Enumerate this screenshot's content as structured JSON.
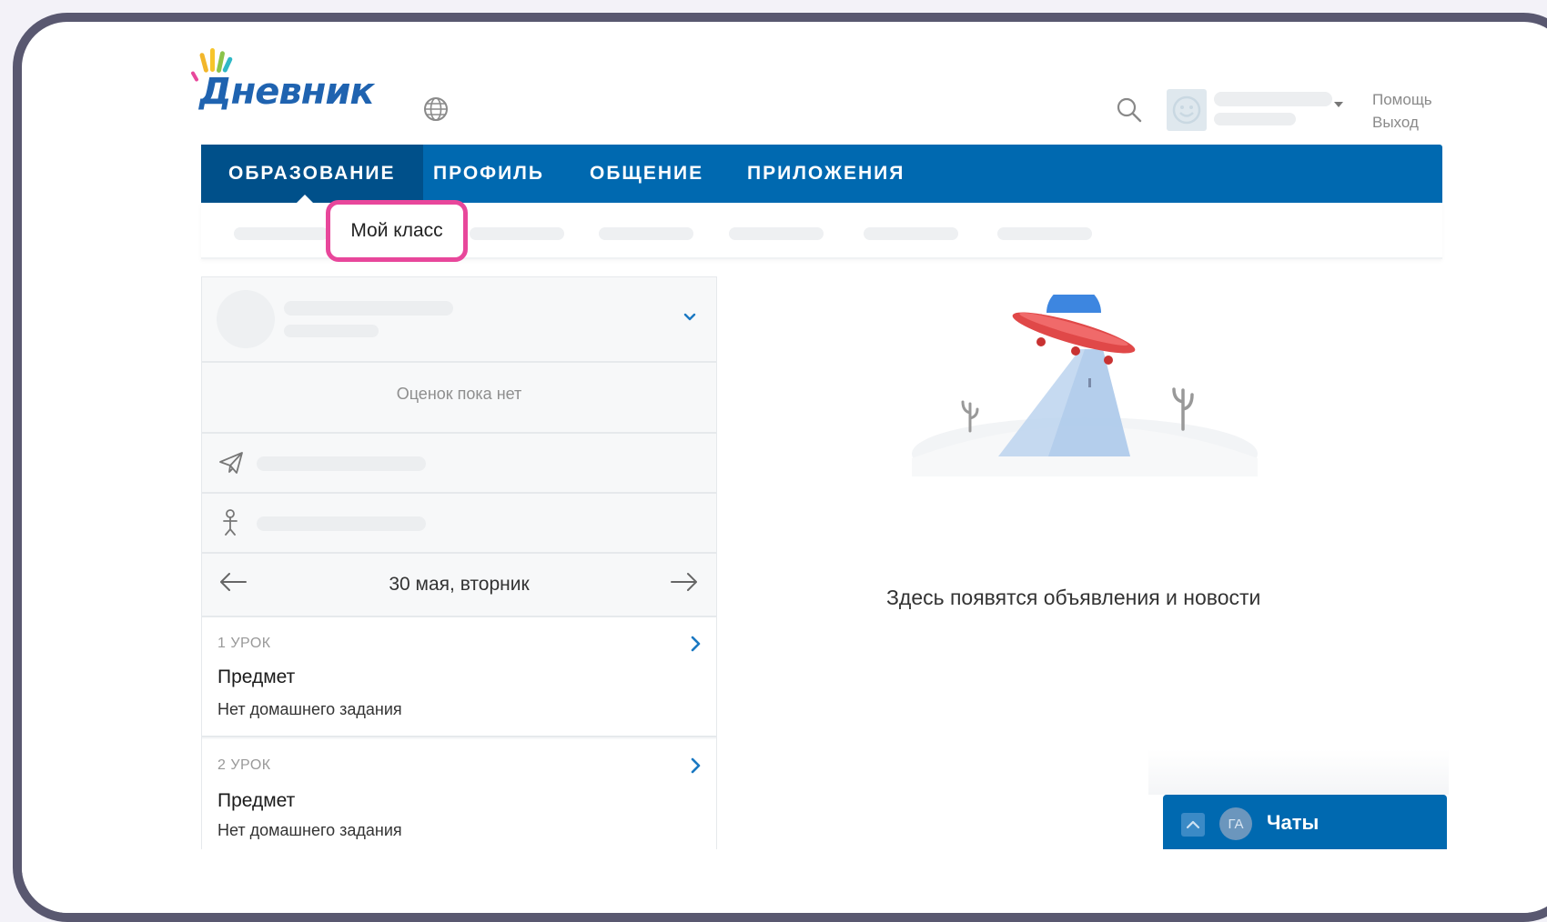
{
  "header": {
    "logo_text": "Дневник",
    "help_link": "Помощь",
    "logout_link": "Выход"
  },
  "nav": {
    "items": [
      {
        "label": "ОБРАЗОВАНИЕ",
        "active": true
      },
      {
        "label": "ПРОФИЛЬ",
        "active": false
      },
      {
        "label": "ОБЩЕНИЕ",
        "active": false
      },
      {
        "label": "ПРИЛОЖЕНИЯ",
        "active": false
      }
    ]
  },
  "subnav": {
    "highlighted_item": "Мой класс"
  },
  "left_panel": {
    "no_grades": "Оценок пока нет",
    "date": "30 мая, вторник",
    "lessons": [
      {
        "number": "1 УРОК",
        "subject": "Предмет",
        "homework": "Нет домашнего задания"
      },
      {
        "number": "2 УРОК",
        "subject": "Предмет",
        "homework": "Нет домашнего задания"
      }
    ]
  },
  "main": {
    "empty_message": "Здесь появятся объявления и новости"
  },
  "chat": {
    "avatar_initials": "ГА",
    "label": "Чаты"
  },
  "colors": {
    "brand_blue": "#0069b0",
    "nav_active": "#00508a",
    "highlight_pink": "#e8479b",
    "frame": "#595870"
  },
  "icons": [
    "globe-icon",
    "search-icon",
    "avatar-smiley-icon",
    "chevron-down-icon",
    "paper-plane-icon",
    "person-icon",
    "arrow-left-icon",
    "arrow-right-icon",
    "chevron-right-icon",
    "chevron-up-icon"
  ]
}
